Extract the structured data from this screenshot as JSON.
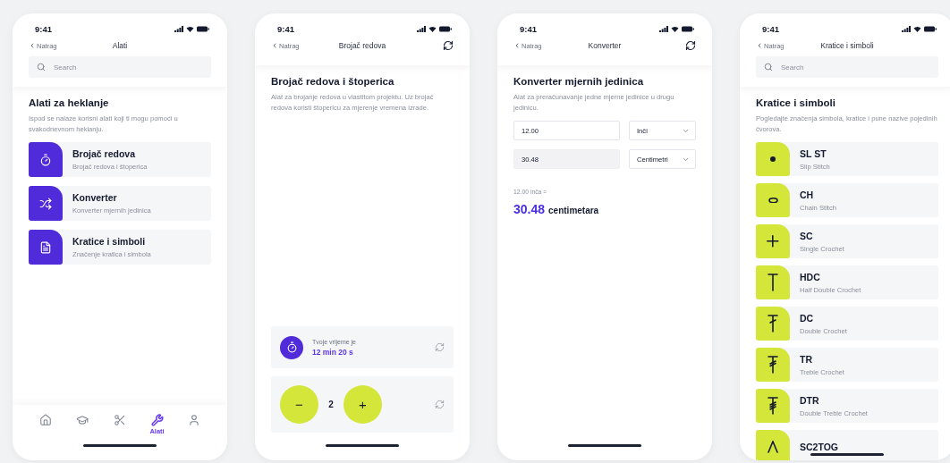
{
  "phones": [
    {
      "kind": "tools",
      "status_time": "9:41",
      "nav": {
        "back": "Natrag",
        "title": "Alati"
      },
      "search": {
        "placeholder": "Search"
      },
      "heading": "Alati za heklanje",
      "description": "Ispod se nalaze korisni alati koji ti mogu pomoći u svakodnevnom heklanju.",
      "tools": [
        {
          "title": "Brojač redova",
          "subtitle": "Brojač redova i štoperica"
        },
        {
          "title": "Konverter",
          "subtitle": "Konverter mjernih jedinica"
        },
        {
          "title": "Kratice i simboli",
          "subtitle": "Značenje kratica i simbola"
        }
      ],
      "tab_bar": [
        {
          "selected": false
        },
        {
          "selected": false
        },
        {
          "selected": false
        },
        {
          "label": "Alati",
          "selected": true
        },
        {
          "selected": false
        }
      ]
    },
    {
      "kind": "counter",
      "status_time": "9:41",
      "nav": {
        "back": "Natrag",
        "title": "Brojač redova",
        "refresh_button": true
      },
      "heading": "Brojač redova i štoperica",
      "description": "Alat za brojanje redova u vlastitom projektu. Uz brojač redova koristi štopericu za mjerenje vremena izrade.",
      "timer": {
        "label": "Tvoje vrijeme je",
        "value": "12 min 20 s"
      },
      "counter": {
        "minus": "−",
        "value": "2",
        "plus": "+"
      }
    },
    {
      "kind": "converter",
      "status_time": "9:41",
      "nav": {
        "back": "Natrag",
        "title": "Konverter",
        "refresh_button": true
      },
      "heading": "Konverter mjernih jedinica",
      "description": "Alat za preračunavanje jedne mjerne jedinice u drugu jedinicu.",
      "rows": [
        {
          "value": "12.00",
          "disabled": false,
          "unit": "Inči"
        },
        {
          "value": "30.48",
          "disabled": true,
          "unit": "Centimetri"
        }
      ],
      "result": {
        "caption": "12.00 inča =",
        "value": "30.48",
        "unit": "centimetara"
      }
    },
    {
      "kind": "symbols",
      "status_time": "9:41",
      "nav": {
        "back": "Natrag",
        "title": "Kratice i simboli"
      },
      "search": {
        "placeholder": "Search"
      },
      "heading": "Kratice i simboli",
      "description": "Pogledajte značenja simbola, kratice i pune nazive pojedinih čvorova.",
      "symbols": [
        {
          "title": "SL ST",
          "subtitle": "Slip Stitch"
        },
        {
          "title": "CH",
          "subtitle": "Chain Stitch"
        },
        {
          "title": "SC",
          "subtitle": "Single Crochet"
        },
        {
          "title": "HDC",
          "subtitle": "Half Double Crochet"
        },
        {
          "title": "DC",
          "subtitle": "Double Crochet"
        },
        {
          "title": "TR",
          "subtitle": "Treble Crochet"
        },
        {
          "title": "DTR",
          "subtitle": "Double Treble Crochet"
        },
        {
          "title": "SC2TOG"
        }
      ]
    }
  ]
}
